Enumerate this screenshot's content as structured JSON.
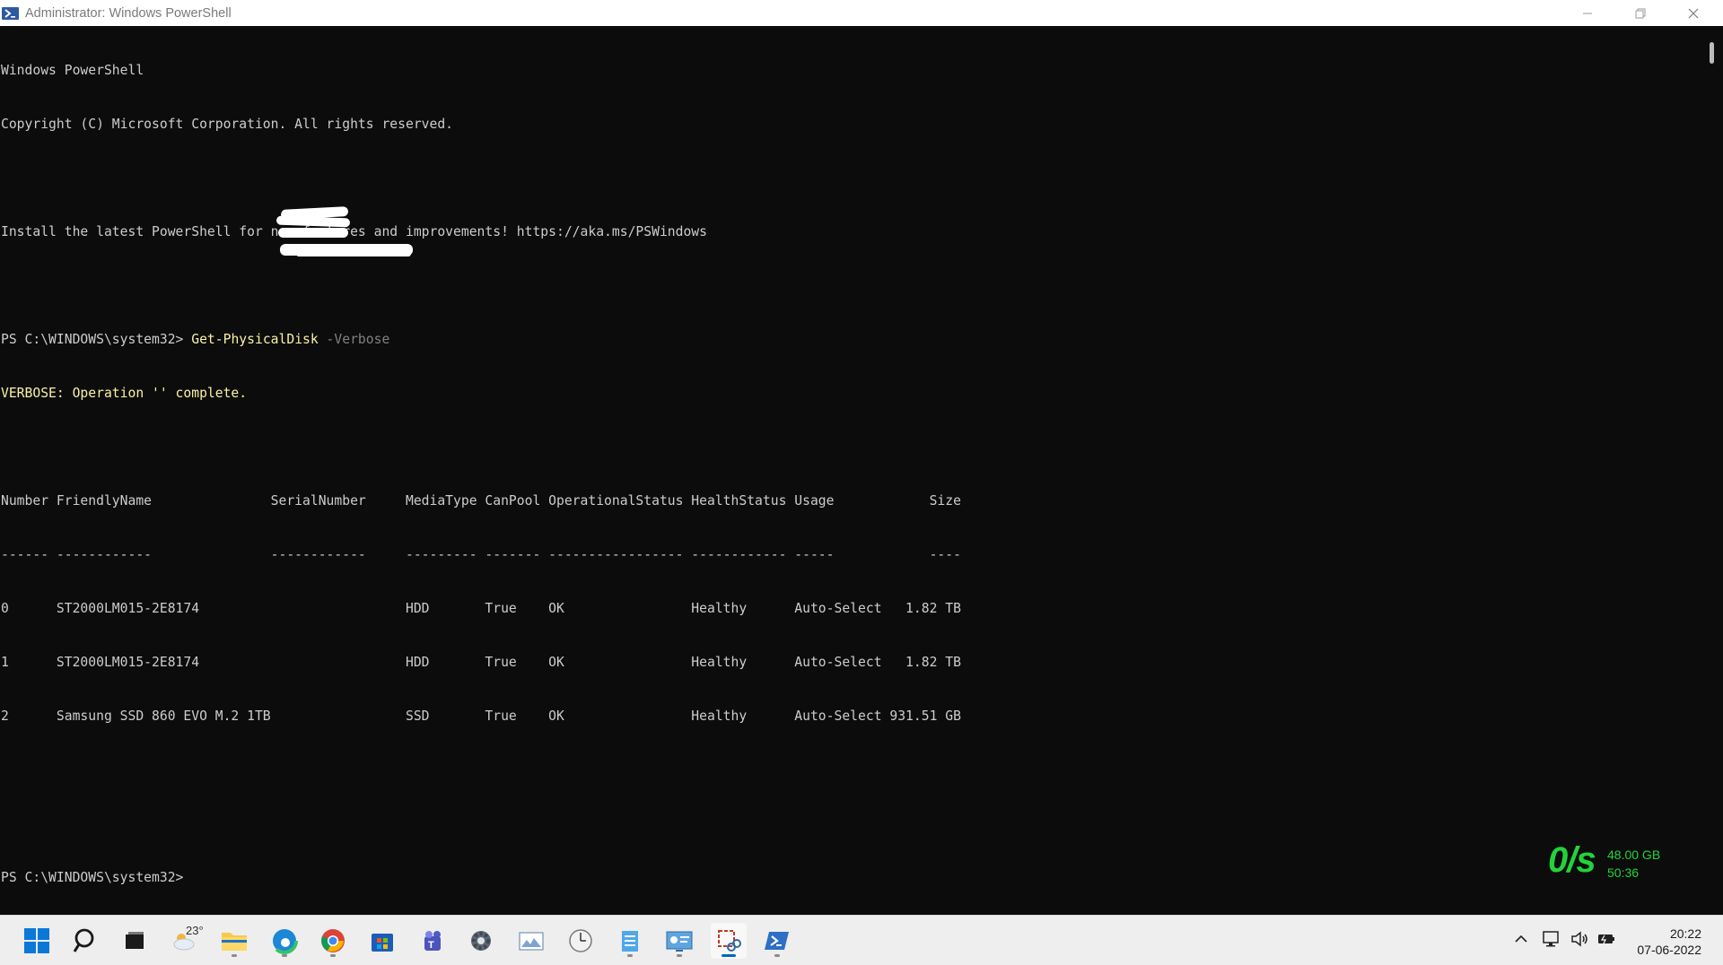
{
  "window": {
    "title": "Administrator: Windows PowerShell",
    "icon": "powershell-icon"
  },
  "console": {
    "banner_line1": "Windows PowerShell",
    "banner_line2": "Copyright (C) Microsoft Corporation. All rights reserved.",
    "install_line": "Install the latest PowerShell for new features and improvements! https://aka.ms/PSWindows",
    "prompt": "PS C:\\WINDOWS\\system32> ",
    "command": "Get-PhysicalDisk",
    "command_param": " -Verbose",
    "verbose_line": "VERBOSE: Operation '' complete.",
    "table": {
      "header": "Number FriendlyName               SerialNumber     MediaType CanPool OperationalStatus HealthStatus Usage            Size",
      "separator": "------ ------------               ------------     --------- ------- ----------------- ------------ -----            ----",
      "rows": [
        "0      ST2000LM015-2E8174                          HDD       True    OK                Healthy      Auto-Select   1.82 TB",
        "1      ST2000LM015-2E8174                          HDD       True    OK                Healthy      Auto-Select   1.82 TB",
        "2      Samsung SSD 860 EVO M.2 1TB                 SSD       True    OK                Healthy      Auto-Select 931.51 GB"
      ]
    },
    "final_prompt": "PS C:\\WINDOWS\\system32>"
  },
  "overlay": {
    "rate": "0/s",
    "capacity": "48.00 GB",
    "time": "50:36"
  },
  "taskbar": {
    "weather_temp": "23°",
    "icons": [
      "windows-start-icon",
      "search-icon",
      "task-view-icon",
      "weather-icon",
      "file-explorer-icon",
      "edge-icon",
      "chrome-icon",
      "store-icon",
      "teams-icon",
      "settings-icon",
      "photos-icon",
      "clock-app-icon",
      "notepad-icon",
      "control-panel-icon",
      "snipping-tool-icon",
      "powershell-icon"
    ],
    "clock_time": "20:22",
    "clock_date": "07-06-2022"
  },
  "colors": {
    "console_bg": "#0c0c0c",
    "console_fg": "#cccccc",
    "command_yellow": "#f9f1a5",
    "overlay_green": "#22d33a",
    "taskbar_bg": "#eeeeee"
  }
}
